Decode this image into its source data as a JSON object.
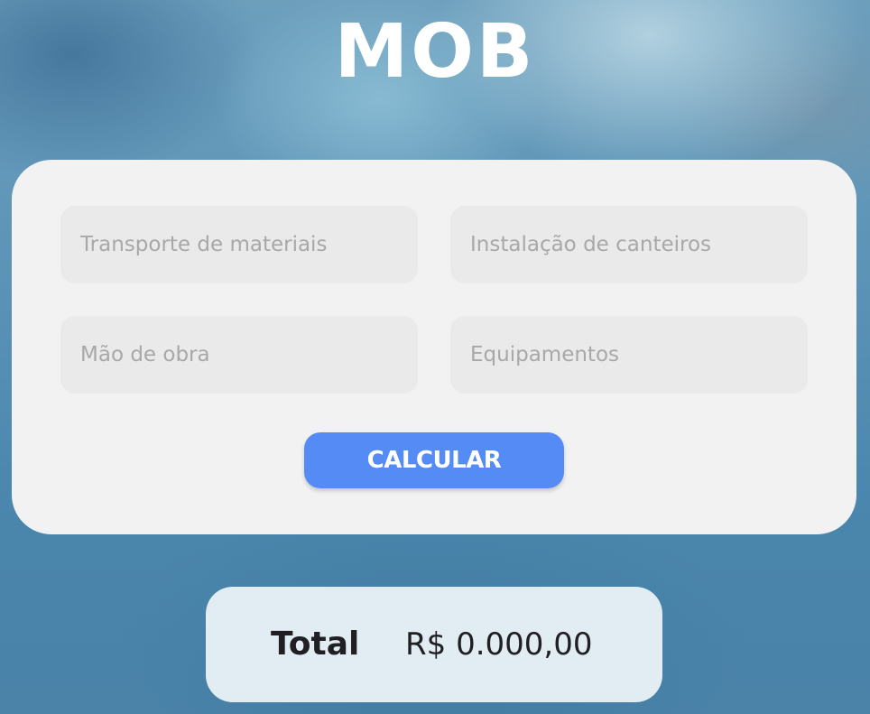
{
  "app": {
    "title": "MOB"
  },
  "form": {
    "fields": [
      {
        "placeholder": "Transporte de materiais",
        "value": ""
      },
      {
        "placeholder": "Instalação de canteiros",
        "value": ""
      },
      {
        "placeholder": "Mão de obra",
        "value": ""
      },
      {
        "placeholder": "Equipamentos",
        "value": ""
      }
    ],
    "calculate_label": "CALCULAR"
  },
  "total": {
    "label": "Total",
    "value": "R$ 0.000,00"
  },
  "colors": {
    "button": "#548bf5",
    "card": "#f2f2f3",
    "field": "#eaeaea",
    "title": "#ffffff"
  }
}
